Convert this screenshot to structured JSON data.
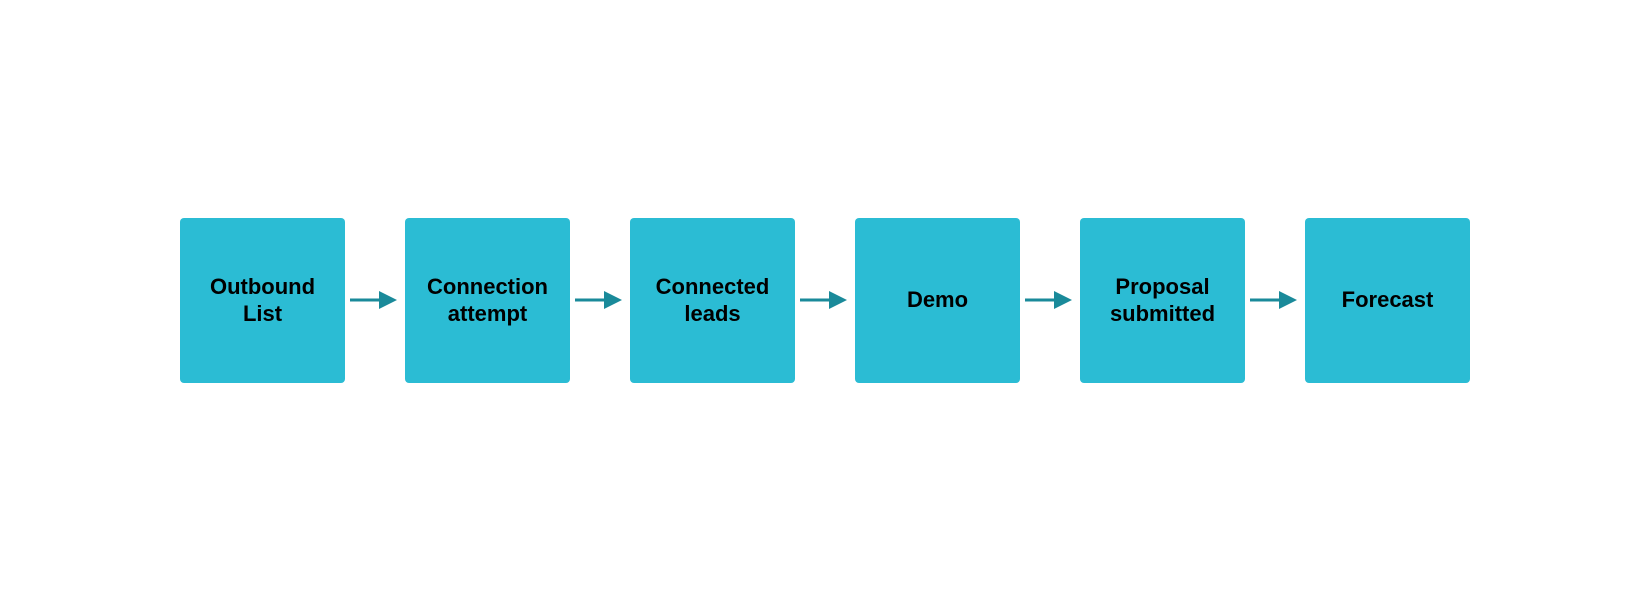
{
  "pipeline": {
    "stages": [
      {
        "id": "outbound-list",
        "label": "Outbound List"
      },
      {
        "id": "connection-attempt",
        "label": "Connection attempt"
      },
      {
        "id": "connected-leads",
        "label": "Connected leads"
      },
      {
        "id": "demo",
        "label": "Demo"
      },
      {
        "id": "proposal-submitted",
        "label": "Proposal submitted"
      },
      {
        "id": "forecast",
        "label": "Forecast"
      }
    ],
    "arrow_color": "#1a8a9a"
  }
}
